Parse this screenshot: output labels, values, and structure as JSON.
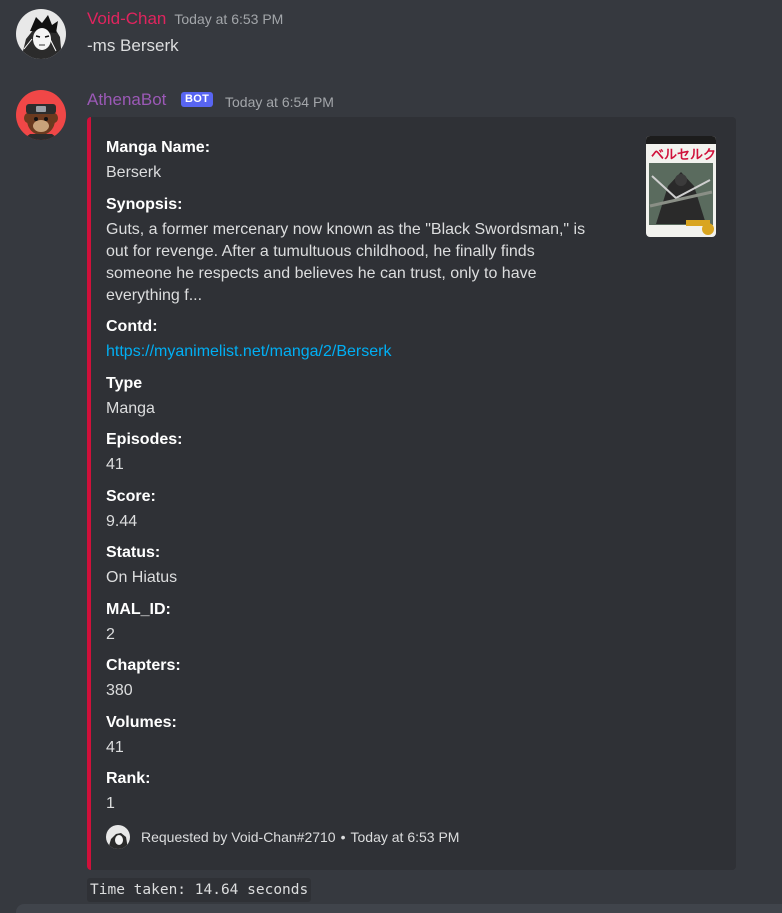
{
  "messages": [
    {
      "username": "Void-Chan",
      "username_color": "#e0245e",
      "timestamp": "Today at 6:53 PM",
      "content": "-ms Berserk",
      "avatar_icon": "manga-avatar-icon"
    },
    {
      "username": "AthenaBot",
      "username_color": "#9b59b6",
      "bot_tag": "BOT",
      "timestamp": "Today at 6:54 PM",
      "avatar_icon": "monkey-avatar-icon"
    }
  ],
  "embed": {
    "accent_color": "#d0103a",
    "fields": [
      {
        "name": "Manga Name:",
        "value": "Berserk"
      },
      {
        "name": "Synopsis:",
        "value": "Guts, a former mercenary now known as the \"Black Swordsman,\" is out for revenge. After a tumultuous childhood, he finally finds someone he respects and believes he can trust, only to have everything f..."
      },
      {
        "name": "Contd:",
        "value": "https://myanimelist.net/manga/2/Berserk"
      },
      {
        "name": "Type",
        "value": "Manga"
      },
      {
        "name": "Episodes:",
        "value": "41"
      },
      {
        "name": "Score:",
        "value": "9.44"
      },
      {
        "name": "Status:",
        "value": "On Hiatus"
      },
      {
        "name": "MAL_ID:",
        "value": "2"
      },
      {
        "name": "Chapters:",
        "value": "380"
      },
      {
        "name": "Volumes:",
        "value": "41"
      },
      {
        "name": "Rank:",
        "value": "1"
      }
    ],
    "thumbnail_icon": "berserk-cover-thumbnail",
    "footer": {
      "text": "Requested by Void-Chan#2710",
      "separator": "•",
      "timestamp": "Today at 6:53 PM"
    }
  },
  "followup": {
    "code_text": "Time taken: 14.64 seconds"
  },
  "colors": {
    "background": "#36393f",
    "embed_background": "#2f3136",
    "link": "#00aff4",
    "bot_tag": "#5865f2"
  }
}
